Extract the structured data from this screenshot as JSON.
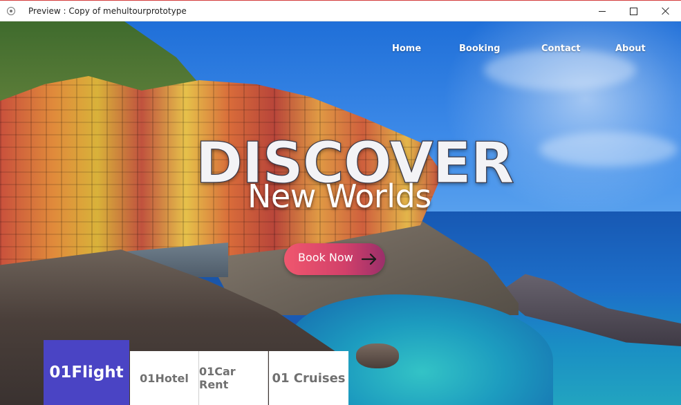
{
  "window": {
    "title": "Preview : Copy of mehultourprototype"
  },
  "nav": {
    "items": [
      {
        "label": "Home"
      },
      {
        "label": "Booking"
      },
      {
        "label": "Contact"
      },
      {
        "label": "About"
      }
    ]
  },
  "hero": {
    "headline": "DISCOVER",
    "subheadline": "New Worlds",
    "cta_label": "Book Now",
    "cta_icon": "arrow-right-icon",
    "cta_gradient": [
      "#f0576e",
      "#9a2f6a"
    ]
  },
  "categories": {
    "active_color": "#4a44c4",
    "tabs": [
      {
        "label": "01Flight",
        "active": true
      },
      {
        "label": "01Hotel",
        "active": false
      },
      {
        "label": "01Car Rent",
        "active": false
      },
      {
        "label": "01 Cruises",
        "active": false
      }
    ]
  }
}
